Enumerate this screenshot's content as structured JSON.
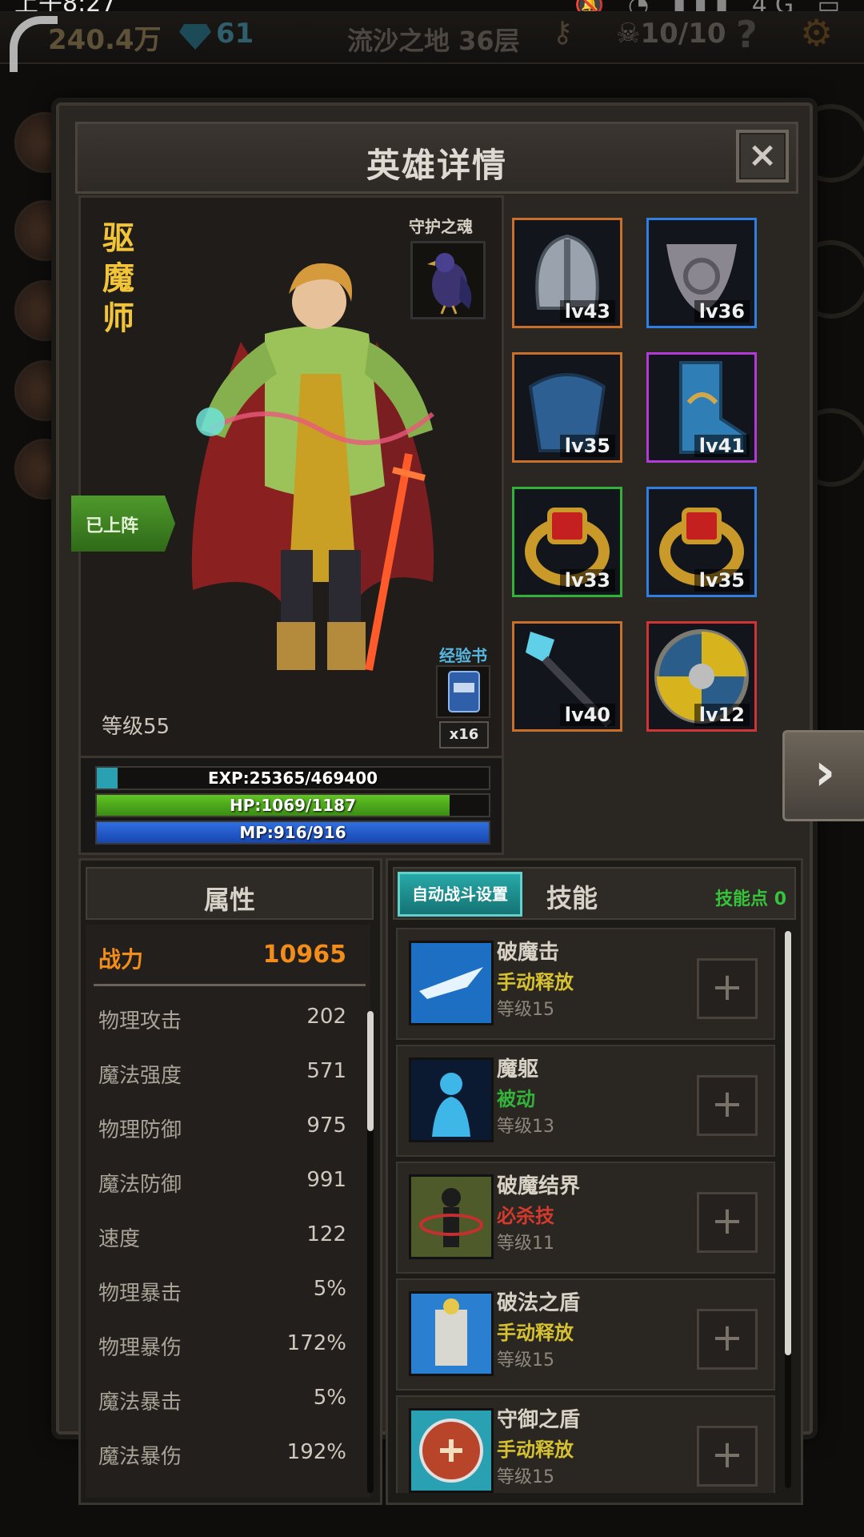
{
  "status_bar": {
    "time": "上午8:27",
    "network": "4G"
  },
  "top_bar": {
    "gold": "240.4万",
    "gems": "61",
    "floor": "流沙之地 36层",
    "skulls": "10/10",
    "help": "?"
  },
  "dialog": {
    "title": "英雄详情",
    "close": "×"
  },
  "hero": {
    "name": "驱魔师",
    "guardian_label": "守护之魂",
    "status_tag": "已上阵",
    "level_text": "等级55",
    "exp_book_label": "经验书",
    "exp_book_count": "x16"
  },
  "bars": {
    "exp": {
      "label": "EXP:25365/469400",
      "current": 25365,
      "max": 469400
    },
    "hp": {
      "label": "HP:1069/1187",
      "current": 1069,
      "max": 1187
    },
    "mp": {
      "label": "MP:916/916",
      "current": 916,
      "max": 916
    }
  },
  "equipment": [
    {
      "name": "helmet-icon",
      "level": "lv43",
      "rarity_color": "#c8702a"
    },
    {
      "name": "cloak-icon",
      "level": "lv36",
      "rarity_color": "#2f7fe0"
    },
    {
      "name": "armor-icon",
      "level": "lv35",
      "rarity_color": "#c8702a"
    },
    {
      "name": "boots-icon",
      "level": "lv41",
      "rarity_color": "#b23ad6"
    },
    {
      "name": "ring-icon",
      "level": "lv33",
      "rarity_color": "#32b13a"
    },
    {
      "name": "ring-icon",
      "level": "lv35",
      "rarity_color": "#2f7fe0"
    },
    {
      "name": "scepter-icon",
      "level": "lv40",
      "rarity_color": "#c8702a"
    },
    {
      "name": "shield-icon",
      "level": "lv12",
      "rarity_color": "#d13434"
    }
  ],
  "attributes": {
    "title": "属性",
    "power_label": "战力",
    "power_value": "10965",
    "rows": [
      {
        "label": "物理攻击",
        "value": "202"
      },
      {
        "label": "魔法强度",
        "value": "571"
      },
      {
        "label": "物理防御",
        "value": "975"
      },
      {
        "label": "魔法防御",
        "value": "991"
      },
      {
        "label": "速度",
        "value": "122"
      },
      {
        "label": "物理暴击",
        "value": "5%"
      },
      {
        "label": "物理暴伤",
        "value": "172%"
      },
      {
        "label": "魔法暴击",
        "value": "5%"
      },
      {
        "label": "魔法暴伤",
        "value": "192%"
      }
    ]
  },
  "skills": {
    "auto_battle_label": "自动战斗设置",
    "title": "技能",
    "points_label": "技能点 0",
    "items": [
      {
        "name": "破魔击",
        "type": "手动释放",
        "type_color": "#d6c230",
        "level": "等级15"
      },
      {
        "name": "魔躯",
        "type": "被动",
        "type_color": "#34b33a",
        "level": "等级13"
      },
      {
        "name": "破魔结界",
        "type": "必杀技",
        "type_color": "#d23a2e",
        "level": "等级11"
      },
      {
        "name": "破法之盾",
        "type": "手动释放",
        "type_color": "#d6c230",
        "level": "等级15"
      },
      {
        "name": "守御之盾",
        "type": "手动释放",
        "type_color": "#d6c230",
        "level": "等级15"
      }
    ],
    "plus": "+"
  },
  "navigation": {
    "next": "›"
  }
}
